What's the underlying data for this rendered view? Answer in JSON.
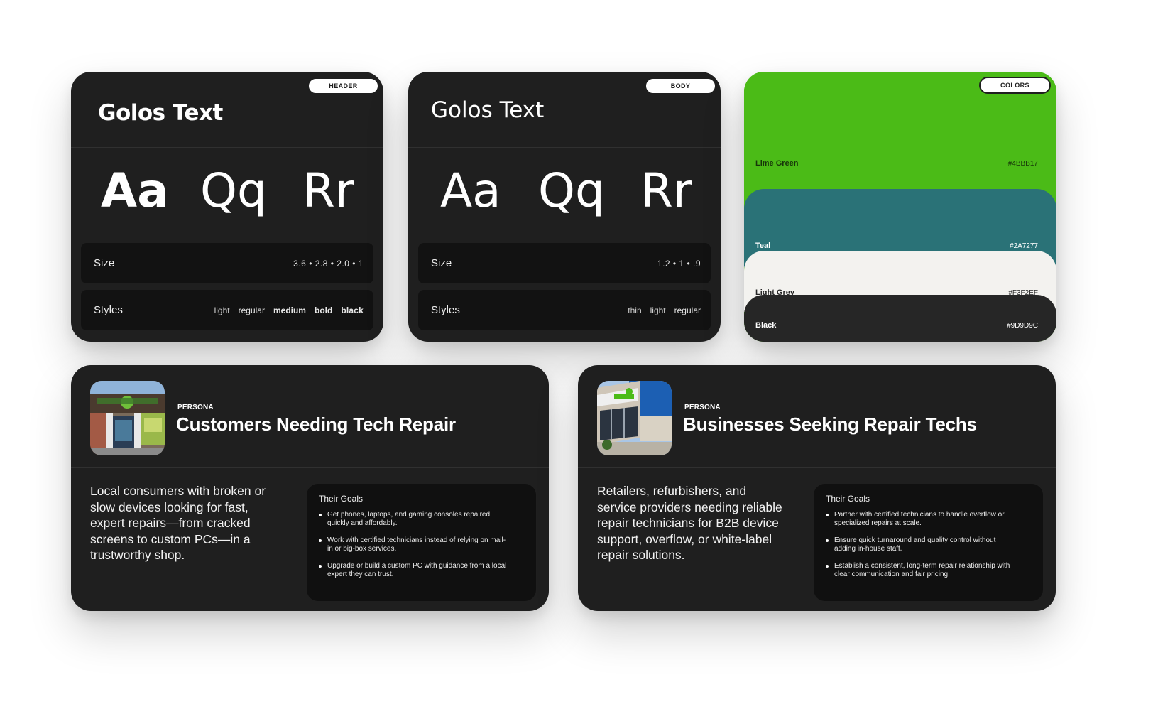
{
  "colors": {
    "lime_green": "#4BBB17",
    "teal": "#2A7277",
    "light_grey": "#F3F2EF",
    "black": "#9D9D9C",
    "card_background": "#1F1F1F"
  },
  "header_card": {
    "pill": "HEADER",
    "font_name": "Golos Text",
    "glyphs": [
      "Aa",
      "Qq",
      "Rr"
    ],
    "size_label": "Size",
    "sizes": "3.6 • 2.8 • 2.0 • 1",
    "styles_label": "Styles",
    "styles": [
      "light",
      "regular",
      "medium",
      "bold",
      "black"
    ]
  },
  "body_card": {
    "pill": "BODY",
    "font_name": "Golos Text",
    "glyphs": [
      "Aa",
      "Qq",
      "Rr"
    ],
    "size_label": "Size",
    "sizes": "1.2 • 1 • .9",
    "styles_label": "Styles",
    "styles": [
      "thin",
      "light",
      "regular"
    ]
  },
  "colors_card": {
    "pill": "COLORS",
    "swatches": [
      {
        "name": "Lime Green",
        "hex": "#4BBB17"
      },
      {
        "name": "Teal",
        "hex": "#2A7277"
      },
      {
        "name": "Light Grey",
        "hex": "#F3F2EF"
      },
      {
        "name": "Black",
        "hex": "#9D9D9C"
      }
    ]
  },
  "personas": [
    {
      "kicker": "PERSONA",
      "title": "Customers Needing Tech Repair",
      "photo_icon": "storefront-photo",
      "description": "Local consumers with broken or slow devices looking for fast, expert repairs—from cracked screens to custom PCs—in a trustworthy shop.",
      "goals_title": "Their Goals",
      "goals": [
        "Get phones, laptops, and gaming consoles repaired quickly and affordably.",
        "Work with certified technicians instead of relying on mail-in or big-box services.",
        "Upgrade or build a custom PC with guidance from a local expert they can trust."
      ]
    },
    {
      "kicker": "PERSONA",
      "title": "Businesses Seeking Repair Techs",
      "photo_icon": "storefront-photo",
      "description": "Retailers, refurbishers, and service providers needing reliable repair technicians for B2B device support, overflow, or white-label repair solutions.",
      "goals_title": "Their Goals",
      "goals": [
        "Partner with certified technicians to handle overflow or specialized repairs at scale.",
        "Ensure quick turnaround and quality control without adding in-house staff.",
        "Establish a consistent, long-term repair relationship with clear communication and fair pricing."
      ]
    }
  ]
}
